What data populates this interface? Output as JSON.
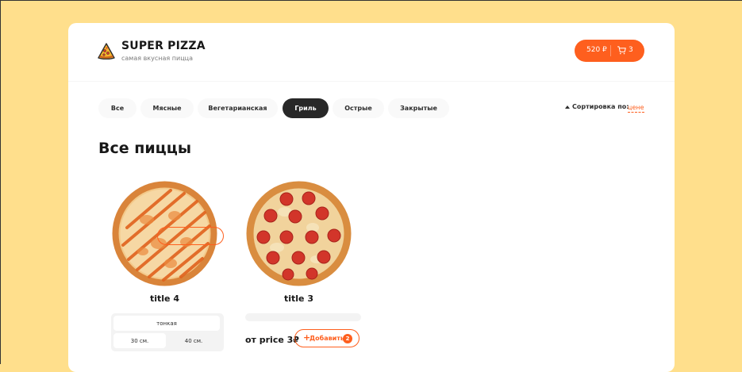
{
  "header": {
    "title": "SUPER PIZZA",
    "subtitle": "самая вкусная пицца",
    "logo_icon": "pizza-slice-icon",
    "cart": {
      "price": "520 ₽",
      "count": "3",
      "icon": "cart-icon"
    }
  },
  "categories": [
    {
      "label": "Все",
      "active": false
    },
    {
      "label": "Мясные",
      "active": false
    },
    {
      "label": "Вегетарианская",
      "active": false
    },
    {
      "label": "Гриль",
      "active": true
    },
    {
      "label": "Острые",
      "active": false
    },
    {
      "label": "Закрытые",
      "active": false
    }
  ],
  "sort": {
    "label": "Сортировка по:",
    "value": "цене",
    "arrow_icon": "triangle-up-icon"
  },
  "page_title": "Все пиццы",
  "pizzas": [
    {
      "title": "title 4",
      "type": "тонкая",
      "sizes": [
        "30 см.",
        "40 см."
      ],
      "active_size": 0
    },
    {
      "title": "title 3",
      "price": "от price 3₽",
      "add_label": "Добавить",
      "add_count": "2"
    }
  ],
  "colors": {
    "background": "#ffdf8c",
    "accent": "#fe5f1e",
    "active_category": "#282828"
  }
}
